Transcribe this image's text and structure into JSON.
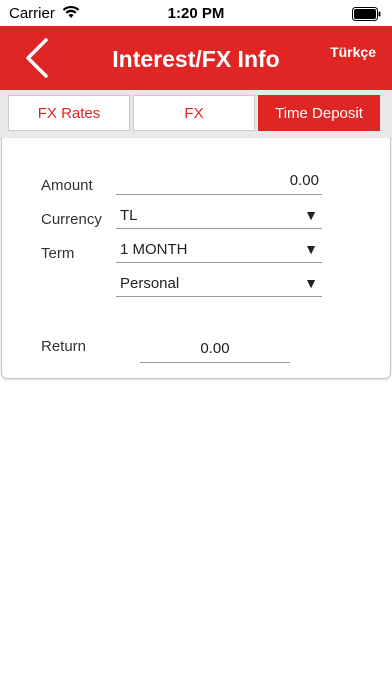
{
  "status_bar": {
    "carrier": "Carrier",
    "time": "1:20 PM"
  },
  "nav": {
    "title": "Interest/FX Info",
    "language_button": "Türkçe"
  },
  "tabs": [
    {
      "label": "FX Rates",
      "active": false
    },
    {
      "label": "FX",
      "active": false
    },
    {
      "label": "Time Deposit",
      "active": true
    }
  ],
  "form": {
    "amount_label": "Amount",
    "amount_value": "0.00",
    "currency_label": "Currency",
    "currency_value": "TL",
    "term_label": "Term",
    "term_value": "1 MONTH",
    "customer_type_value": "Personal",
    "return_label": "Return",
    "return_value": "0.00",
    "dropdown_arrow": "▼"
  },
  "colors": {
    "accent": "#e02624"
  }
}
